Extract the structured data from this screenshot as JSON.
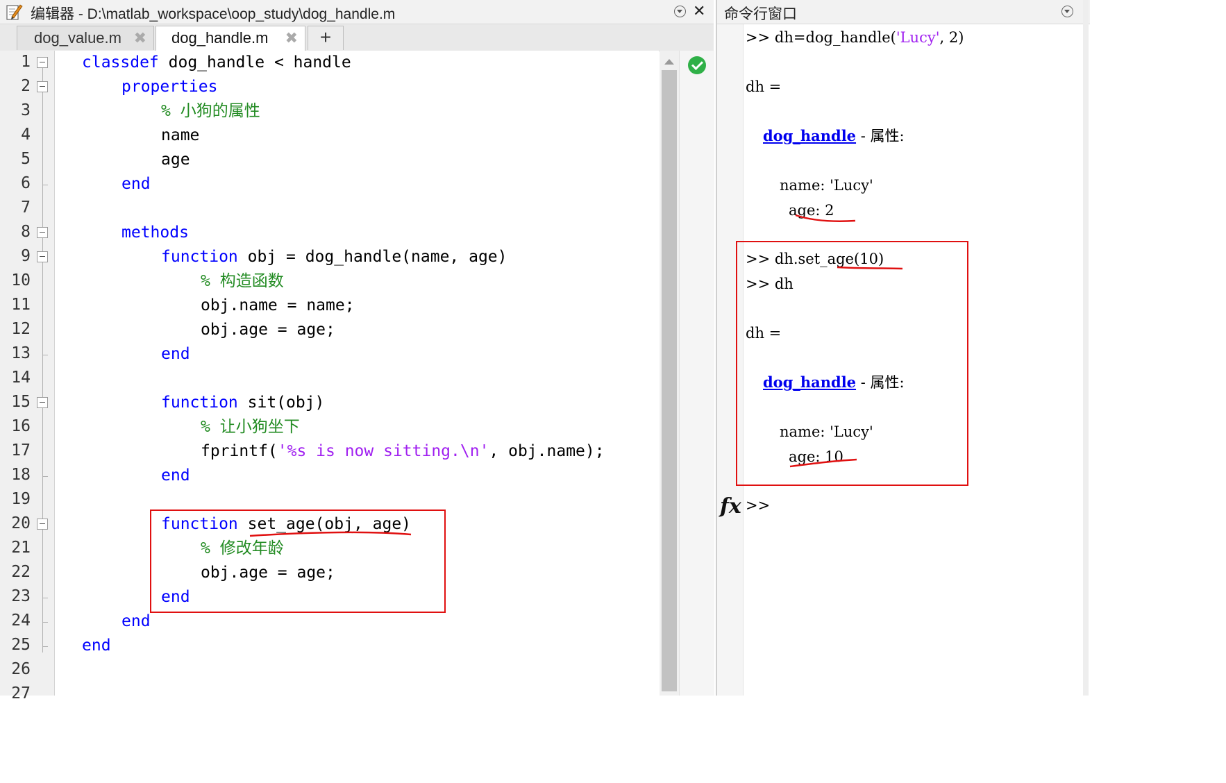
{
  "editor": {
    "title": "编辑器 - D:\\matlab_workspace\\oop_study\\dog_handle.m",
    "tabs": [
      {
        "label": "dog_value.m",
        "active": false
      },
      {
        "label": "dog_handle.m",
        "active": true
      }
    ],
    "add_tab_label": "+",
    "close_label": "✕",
    "status": "no-issues-icon",
    "line_numbers": [
      "1",
      "2",
      "3",
      "4",
      "5",
      "6",
      "7",
      "8",
      "9",
      "10",
      "11",
      "12",
      "13",
      "14",
      "15",
      "16",
      "17",
      "18",
      "19",
      "20",
      "21",
      "22",
      "23",
      "24",
      "25",
      "26",
      "27"
    ],
    "code": {
      "l1_kw": "classdef",
      "l1_rest": " dog_handle < handle",
      "l2_kw": "properties",
      "l3_cm": "% 小狗的属性",
      "l4": "name",
      "l5": "age",
      "l6_kw": "end",
      "l8_kw": "methods",
      "l9_kw": "function",
      "l9_rest": " obj = dog_handle(name, age)",
      "l10_cm": "% 构造函数",
      "l11": "obj.name = name;",
      "l12": "obj.age = age;",
      "l13_kw": "end",
      "l15_kw": "function",
      "l15_rest": " sit(obj)",
      "l16_cm": "% 让小狗坐下",
      "l17_a": "fprintf(",
      "l17_str": "'%s is now sitting.\\n'",
      "l17_b": ", obj.name);",
      "l18_kw": "end",
      "l20_kw": "function",
      "l20_rest": " set_age(obj, age)",
      "l21_cm": "% 修改年龄",
      "l22": "obj.age = age;",
      "l23_kw": "end",
      "l24_kw": "end",
      "l25_kw": "end"
    }
  },
  "command_window": {
    "title": "命令行窗口",
    "fx_label": "fx",
    "lines": {
      "c1_prompt": ">> ",
      "c1_a": "dh=dog_handle(",
      "c1_str": "'Lucy'",
      "c1_b": ", 2)",
      "c2": "dh =",
      "c3_link": "dog_handle",
      "c3_rest": " - 属性:",
      "c4": "name: 'Lucy'",
      "c5": "age: 2",
      "c6": ">> dh.set_age(10)",
      "c7": ">> dh",
      "c8": "dh =",
      "c9_link": "dog_handle",
      "c9_rest": " - 属性:",
      "c10": "name: 'Lucy'",
      "c11": "age: 10",
      "c12": ">>"
    }
  },
  "colors": {
    "keyword": "#0000ff",
    "comment": "#228b22",
    "string": "#a020f0",
    "annotation": "#e01010"
  }
}
